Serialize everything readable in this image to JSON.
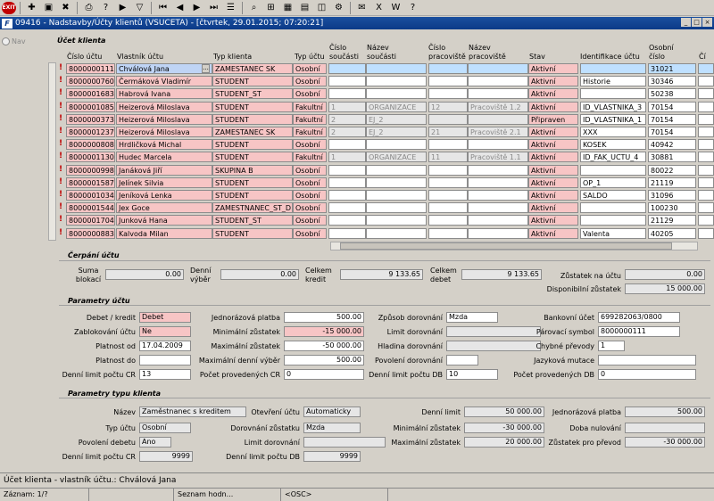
{
  "title_bar": {
    "text": "09416 - Nadstavby/Účty klientů (VSUCETA) - [čtvrtek, 29.01.2015; 07:20:21]"
  },
  "toolbar_icons": [
    "exit-icon",
    "new-icon",
    "save-icon",
    "delete-icon",
    "print-icon",
    "query-icon",
    "execute-icon",
    "filter-icon",
    "first-icon",
    "prev-icon",
    "next-icon",
    "last-icon",
    "list-icon",
    "find-icon",
    "tree-icon",
    "grid-icon",
    "calc-icon",
    "image-icon",
    "settings-icon",
    "mail-icon",
    "excel-icon",
    "word-icon",
    "help-icon"
  ],
  "nav_tab": {
    "label": "Nav"
  },
  "account_section": {
    "title": "Účet klienta",
    "headers": {
      "account_no": "Číslo účtu",
      "owner": "Vlastník účtu",
      "client_type": "Typ klienta",
      "account_type": "Typ účtu",
      "part_no": "Číslo součásti",
      "part_name": "Název součásti",
      "workplace_no": "Číslo pracoviště",
      "workplace_name": "Název pracoviště",
      "status": "Stav",
      "account_id": "Identifikace účtu",
      "personal_no": "Osobní číslo",
      "extra": "Čí"
    },
    "rows": [
      {
        "no": "8000000111",
        "owner": "Chválová Jana",
        "client_type": "ZAMESTANEC SK",
        "account_type": "Osobní",
        "part_no": "",
        "part_name": "",
        "workplace_no": "",
        "workplace_name": "",
        "status": "Aktivní",
        "account_id": "",
        "personal_no": "31021"
      },
      {
        "no": "8000000760",
        "owner": "Čermáková Vladimír",
        "client_type": "STUDENT",
        "account_type": "Osobní",
        "part_no": "",
        "part_name": "",
        "workplace_no": "",
        "workplace_name": "",
        "status": "Aktivní",
        "account_id": "Historie",
        "personal_no": "30346"
      },
      {
        "no": "8000001683",
        "owner": "Habrová Ivana",
        "client_type": "STUDENT_ST",
        "account_type": "Osobní",
        "part_no": "",
        "part_name": "",
        "workplace_no": "",
        "workplace_name": "",
        "status": "Aktivní",
        "account_id": "",
        "personal_no": "50238"
      },
      {
        "no": "8000001085",
        "owner": "Heizerová Miloslava",
        "client_type": "STUDENT",
        "account_type": "Fakultní",
        "part_no": "1",
        "part_name": "ORGANIZACE",
        "workplace_no": "12",
        "workplace_name": "Pracoviště 1.2",
        "status": "Aktivní",
        "account_id": "ID_VLASTNIKA_3",
        "personal_no": "70154"
      },
      {
        "no": "8000000373",
        "owner": "Heizerová Miloslava",
        "client_type": "STUDENT",
        "account_type": "Fakultní",
        "part_no": "2",
        "part_name": "EJ_2",
        "workplace_no": "",
        "workplace_name": "",
        "status": "Připraven",
        "account_id": "ID_VLASTNIKA_1",
        "personal_no": "70154"
      },
      {
        "no": "8000001237",
        "owner": "Heizerová Miloslava",
        "client_type": "ZAMESTANEC SK",
        "account_type": "Fakultní",
        "part_no": "2",
        "part_name": "EJ_2",
        "workplace_no": "21",
        "workplace_name": "Pracoviště 2.1",
        "status": "Aktivní",
        "account_id": "XXX",
        "personal_no": "70154"
      },
      {
        "no": "8000000808",
        "owner": "Hrdličková Michal",
        "client_type": "STUDENT",
        "account_type": "Osobní",
        "part_no": "",
        "part_name": "",
        "workplace_no": "",
        "workplace_name": "",
        "status": "Aktivní",
        "account_id": "KOSEK",
        "personal_no": "40942"
      },
      {
        "no": "8000001130",
        "owner": "Hudec Marcela",
        "client_type": "STUDENT",
        "account_type": "Fakultní",
        "part_no": "1",
        "part_name": "ORGANIZACE",
        "workplace_no": "11",
        "workplace_name": "Pracoviště 1.1",
        "status": "Aktivní",
        "account_id": "ID_FAK_UCTU_4",
        "personal_no": "30881"
      },
      {
        "no": "8000000998",
        "owner": "Janáková Jiří",
        "client_type": "SKUPINA B",
        "account_type": "Osobní",
        "part_no": "",
        "part_name": "",
        "workplace_no": "",
        "workplace_name": "",
        "status": "Aktivní",
        "account_id": "",
        "personal_no": "80022"
      },
      {
        "no": "8000001587",
        "owner": "Jelínek Silvia",
        "client_type": "STUDENT",
        "account_type": "Osobní",
        "part_no": "",
        "part_name": "",
        "workplace_no": "",
        "workplace_name": "",
        "status": "Aktivní",
        "account_id": "OP_1",
        "personal_no": "21119"
      },
      {
        "no": "8000001034",
        "owner": "Jeníková Lenka",
        "client_type": "STUDENT",
        "account_type": "Osobní",
        "part_no": "",
        "part_name": "",
        "workplace_no": "",
        "workplace_name": "",
        "status": "Aktivní",
        "account_id": "SALDO",
        "personal_no": "31096"
      },
      {
        "no": "8000001544",
        "owner": "Jex Goce",
        "client_type": "ZAMESTNANEC_ST_D",
        "account_type": "Osobní",
        "part_no": "",
        "part_name": "",
        "workplace_no": "",
        "workplace_name": "",
        "status": "Aktivní",
        "account_id": "",
        "personal_no": "100230"
      },
      {
        "no": "8000001704",
        "owner": "Junková Hana",
        "client_type": "STUDENT_ST",
        "account_type": "Osobní",
        "part_no": "",
        "part_name": "",
        "workplace_no": "",
        "workplace_name": "",
        "status": "Aktivní",
        "account_id": "",
        "personal_no": "21129"
      },
      {
        "no": "8000000883",
        "owner": "Kalvoda Milan",
        "client_type": "STUDENT",
        "account_type": "Osobní",
        "part_no": "",
        "part_name": "",
        "workplace_no": "",
        "workplace_name": "",
        "status": "Aktivní",
        "account_id": "Valenta",
        "personal_no": "40205"
      }
    ]
  },
  "usage": {
    "title": "Čerpání účtu",
    "sum_blocked_label": "Suma blokací",
    "sum_blocked": "0.00",
    "daily_withdraw_label": "Denní výběr",
    "daily_withdraw": "0.00",
    "total_credit_label": "Celkem kredit",
    "total_credit": "9 133.65",
    "total_debit_label": "Celkem debet",
    "total_debit": "9 133.65",
    "balance_label": "Zůstatek na účtu",
    "balance": "0.00",
    "available_label": "Disponibilní zůstatek",
    "available": "15 000.00"
  },
  "account_params": {
    "title": "Parametry účtu",
    "debit_credit_label": "Debet / kredit",
    "debit_credit": "Debet",
    "blocked_label": "Zablokování účtu",
    "blocked": "Ne",
    "valid_from_label": "Platnost od",
    "valid_from": "17.04.2009",
    "valid_to_label": "Platnost do",
    "valid_to": "",
    "daily_limit_cr_label": "Denní limit počtu CR",
    "daily_limit_cr": "13",
    "one_time_label": "Jednorázová platba",
    "one_time": "500.00",
    "min_balance_label": "Minimální zůstatek",
    "min_balance": "-15 000.00",
    "max_balance_label": "Maximální zůstatek",
    "max_balance": "-50 000.00",
    "max_daily_label": "Maximální denní výběr",
    "max_daily": "500.00",
    "cr_count_label": "Počet provedených CR",
    "cr_count": "0",
    "topup_label": "Způsob dorovnání",
    "topup": "Mzda",
    "limit_topup_label": "Limit dorovnání",
    "limit_topup": "",
    "level_topup_label": "Hladina dorovnání",
    "level_topup": "",
    "allow_topup_label": "Povolení dorovnání",
    "allow_topup": "",
    "daily_limit_db_label": "Denní limit počtu DB",
    "daily_limit_db": "10",
    "bank_acc_label": "Bankovní účet",
    "bank_acc": "699282063/0800",
    "pair_symbol_label": "Párovací symbol",
    "pair_symbol": "8000000111",
    "wrong_transfers_label": "Chybné převody",
    "wrong_transfers": "1",
    "language_label": "Jazyková mutace",
    "language": "",
    "db_count_label": "Počet provedených DB",
    "db_count": "0"
  },
  "client_type_params": {
    "title": "Parametry typu klienta",
    "name_label": "Název",
    "name": "Zaměstnanec s kreditem",
    "acc_type_label": "Typ účtu",
    "acc_type": "Osobní",
    "allow_debit_label": "Povolení debetu",
    "allow_debit": "Ano",
    "daily_limit_cr_label": "Denní limit počtu CR",
    "daily_limit_cr": "9999",
    "opening_label": "Otevření účtu",
    "opening": "Automaticky",
    "topup_label": "Dorovnání zůstatku",
    "topup": "Mzda",
    "limit_topup_label": "Limit dorovnání",
    "limit_topup": "",
    "daily_limit_db_label": "Denní limit počtu DB",
    "daily_limit_db": "9999",
    "daily_limit_label": "Denní limit",
    "daily_limit": "50 000.00",
    "min_balance_label": "Minimální zůstatek",
    "min_balance": "-30 000.00",
    "max_balance_label": "Maximální zůstatek",
    "max_balance": "20 000.00",
    "one_time_label": "Jednorázová platba",
    "one_time": "500.00",
    "validity_label": "Doba nulování",
    "validity": "",
    "transfer_label": "Zůstatek pro převod",
    "transfer": "-30 000.00"
  },
  "status_bar": {
    "text": "Účet klienta - vlastník účtu.: Chválová Jana"
  },
  "bottom_bar": {
    "record": "Záznam: 1/?",
    "list": "Seznam hodn...",
    "osc": "<OSC>"
  }
}
